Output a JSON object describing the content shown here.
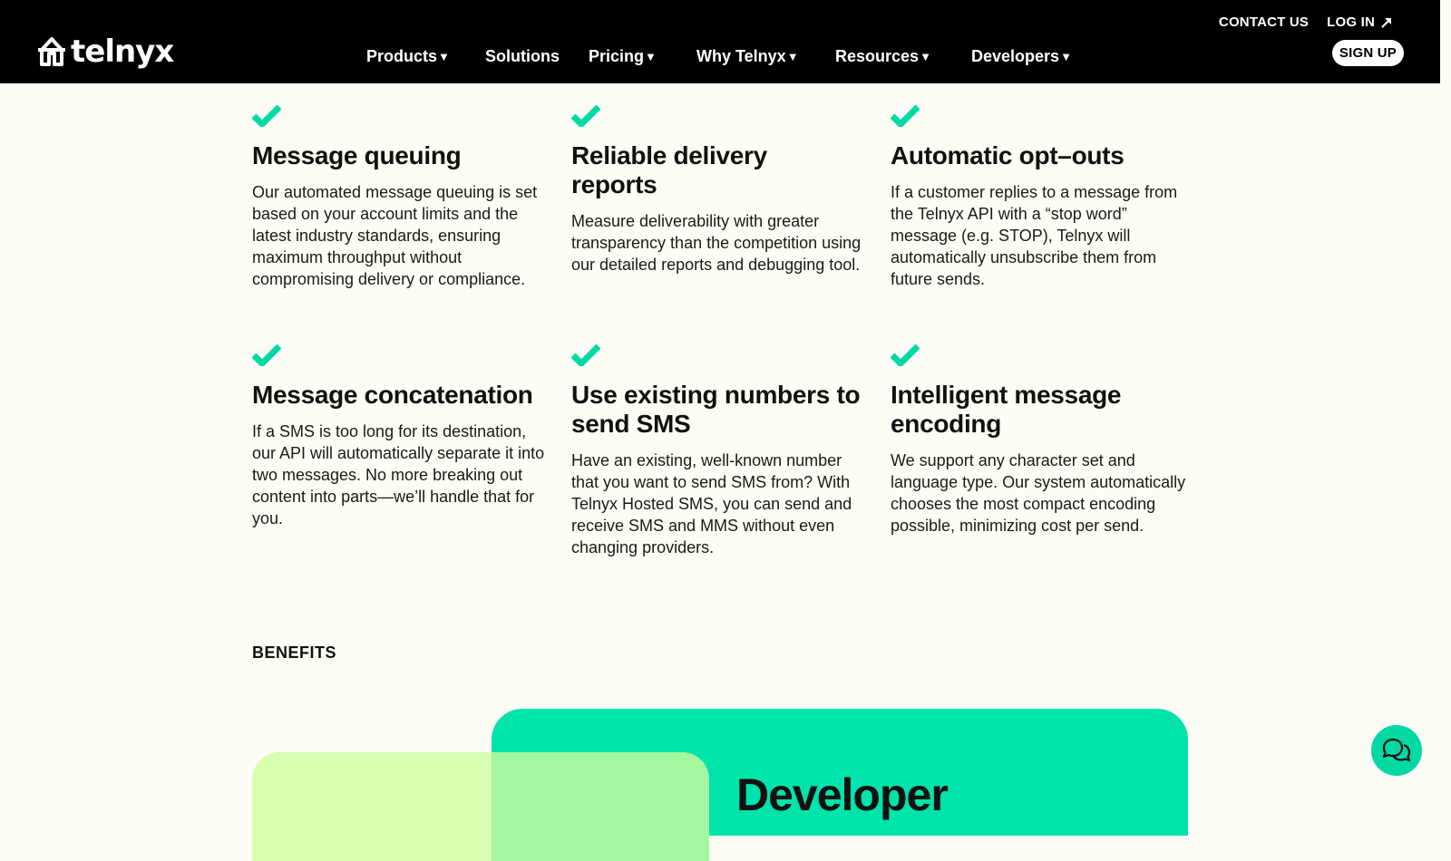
{
  "header": {
    "logo_text": "telnyx",
    "util_links": [
      {
        "label": "CONTACT US"
      },
      {
        "label": "LOG IN",
        "icon": "external-arrow-icon"
      }
    ],
    "nav": [
      {
        "label": "Products",
        "dropdown": true
      },
      {
        "label": "Solutions",
        "dropdown": false
      },
      {
        "label": "Pricing",
        "dropdown": true
      },
      {
        "label": "Why Telnyx",
        "dropdown": true
      },
      {
        "label": "Resources",
        "dropdown": true
      },
      {
        "label": "Developers",
        "dropdown": true
      }
    ],
    "signup_label": "SIGN UP"
  },
  "features": [
    {
      "title": "Message queuing",
      "body": "Our automated message queuing is set based on your account limits and the latest industry standards, ensuring maximum throughput without compromising delivery or compliance."
    },
    {
      "title": "Reliable delivery reports",
      "body": "Measure deliverability with greater transparency than the competition using our detailed reports and debugging tool."
    },
    {
      "title": "Automatic opt–outs",
      "body": "If a customer replies to a message from the Telnyx API with a “stop word” message (e.g. STOP), Telnyx will automatically unsubscribe them from future sends."
    },
    {
      "title": "Message concatenation",
      "body": "If a SMS is too long for its destination, our API will automatically separate it into two messages. No more breaking out content into parts—we’ll handle that for you."
    },
    {
      "title": "Use existing numbers to send SMS",
      "body": "Have an existing, well-known number that you want to send SMS from? With Telnyx Hosted SMS, you can send and receive SMS and MMS without even changing providers."
    },
    {
      "title": "Intelligent message encoding",
      "body": "We support any character set and language type. Our system automatically chooses the most compact encoding possible, minimizing cost per send."
    }
  ],
  "benefits_label": "BENEFITS",
  "panel_heading": "Developer",
  "colors": {
    "accent": "#00e3aa",
    "check": "#00d9a3",
    "lime": "#d8ffb0",
    "header_bg": "#000000",
    "page_bg": "#fdfdf6"
  },
  "chat_icon": "chat-bubble-icon"
}
